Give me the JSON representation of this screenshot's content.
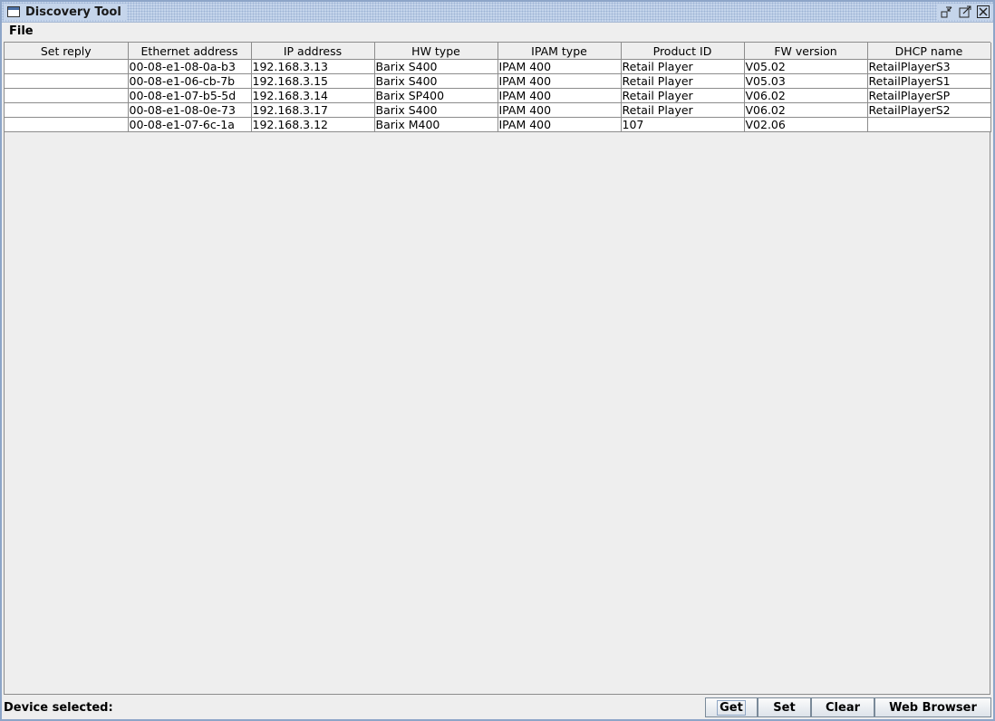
{
  "window": {
    "title": "Discovery Tool",
    "icons": [
      "window-app-icon",
      "iconify-icon",
      "maximize-icon",
      "close-icon"
    ]
  },
  "menu": {
    "file_label": "File"
  },
  "table": {
    "columns": [
      "Set reply",
      "Ethernet address",
      "IP address",
      "HW type",
      "IPAM type",
      "Product ID",
      "FW version",
      "DHCP name"
    ],
    "rows": [
      [
        "",
        "00-08-e1-08-0a-b3",
        "192.168.3.13",
        "Barix S400",
        "IPAM 400",
        "Retail Player",
        "V05.02",
        "RetailPlayerS3"
      ],
      [
        "",
        "00-08-e1-06-cb-7b",
        "192.168.3.15",
        "Barix S400",
        "IPAM 400",
        "Retail Player",
        "V05.03",
        "RetailPlayerS1"
      ],
      [
        "",
        "00-08-e1-07-b5-5d",
        "192.168.3.14",
        "Barix SP400",
        "IPAM 400",
        "Retail Player",
        "V06.02",
        "RetailPlayerSP"
      ],
      [
        "",
        "00-08-e1-08-0e-73",
        "192.168.3.17",
        "Barix S400",
        "IPAM 400",
        "Retail Player",
        "V06.02",
        "RetailPlayerS2"
      ],
      [
        "",
        "00-08-e1-07-6c-1a",
        "192.168.3.12",
        "Barix M400",
        "IPAM 400",
        "107",
        "V02.06",
        ""
      ]
    ]
  },
  "status": {
    "device_selected_label": "Device selected:"
  },
  "buttons": {
    "get": "Get",
    "set": "Set",
    "clear": "Clear",
    "web_browser": "Web Browser"
  },
  "colors": {
    "title_bar": "#c5d5eb",
    "window_border": "#8da5c8",
    "background": "#eeeeee"
  }
}
